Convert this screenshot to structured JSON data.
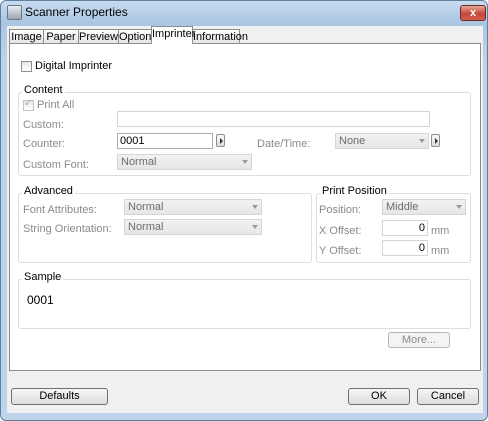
{
  "window": {
    "title": "Scanner Properties",
    "close_glyph": "x"
  },
  "tabs": [
    {
      "label": "Image"
    },
    {
      "label": "Paper"
    },
    {
      "label": "Preview"
    },
    {
      "label": "Options"
    },
    {
      "label": "Imprinter"
    },
    {
      "label": "Information"
    }
  ],
  "digital_imprinter": {
    "label": "Digital Imprinter",
    "checked": false
  },
  "content": {
    "title": "Content",
    "print_all": {
      "label": "Print All",
      "checked": true
    },
    "custom_label": "Custom:",
    "custom_value": "",
    "counter_label": "Counter:",
    "counter_value": "0001",
    "datetime_label": "Date/Time:",
    "datetime_value": "None",
    "font_label": "Custom Font:",
    "font_value": "Normal"
  },
  "advanced": {
    "title": "Advanced",
    "font_attr_label": "Font Attributes:",
    "font_attr_value": "Normal",
    "orientation_label": "String Orientation:",
    "orientation_value": "Normal"
  },
  "print_position": {
    "title": "Print Position",
    "position_label": "Position:",
    "position_value": "Middle",
    "x_label": "X Offset:",
    "x_value": "0",
    "x_unit": "mm",
    "y_label": "Y Offset:",
    "y_value": "0",
    "y_unit": "mm"
  },
  "sample": {
    "title": "Sample",
    "text": "0001"
  },
  "buttons": {
    "more": "More...",
    "defaults": "Defaults",
    "ok": "OK",
    "cancel": "Cancel"
  }
}
